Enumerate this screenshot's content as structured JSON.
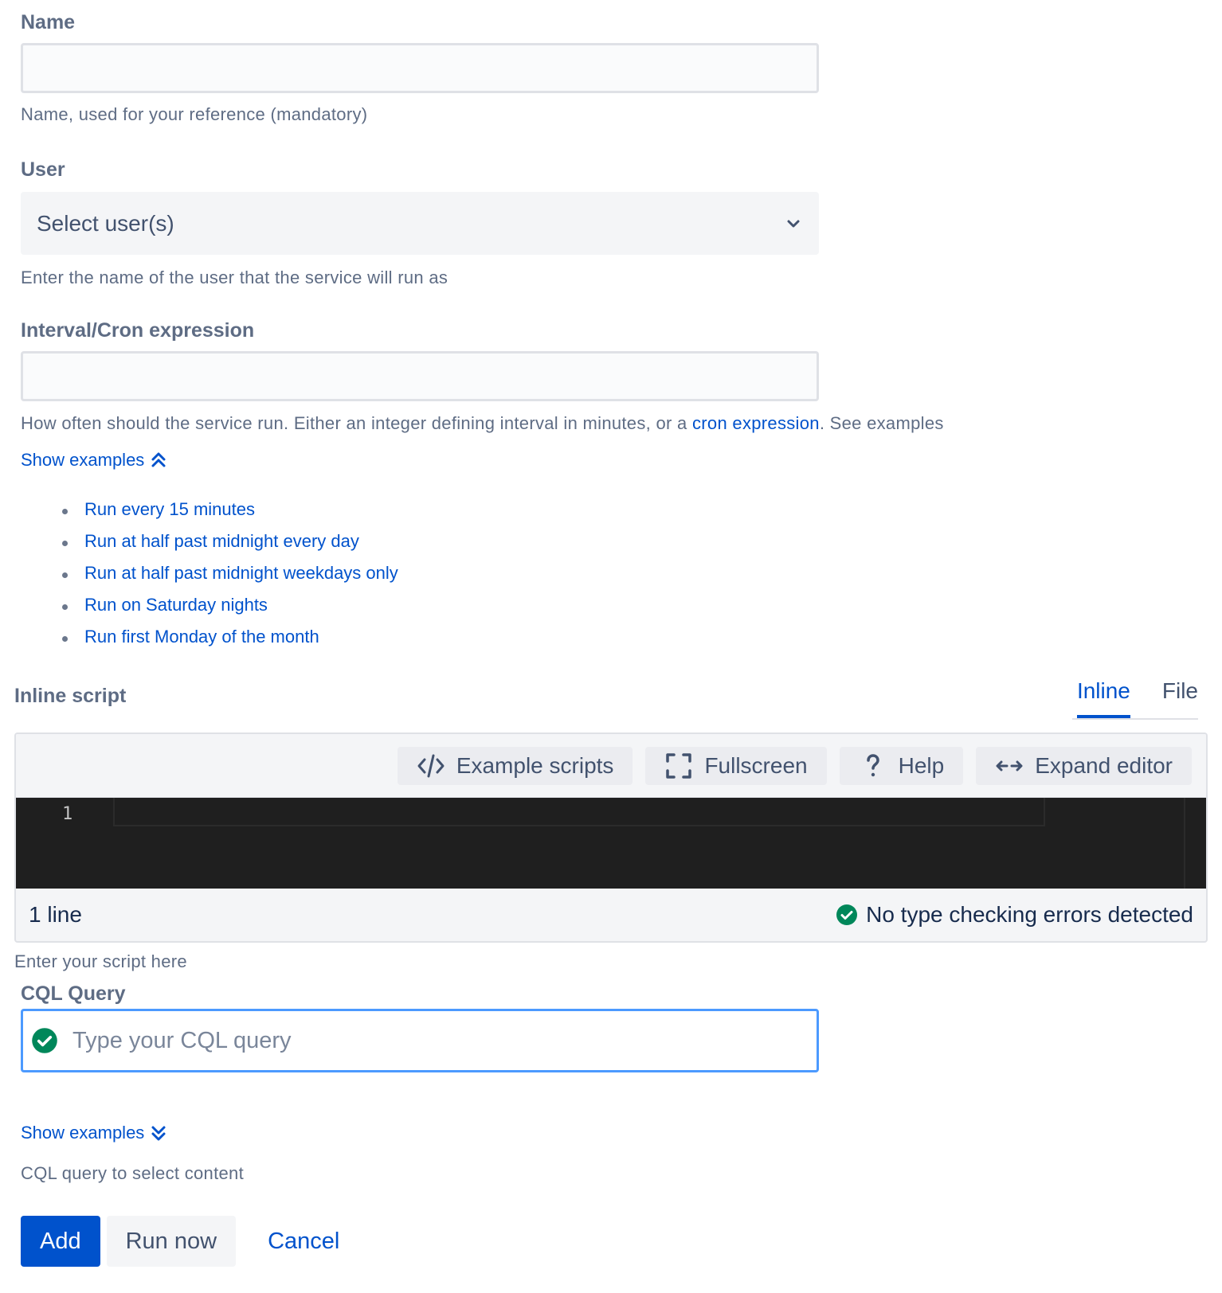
{
  "name_field": {
    "label": "Name",
    "value": "",
    "help": "Name, used for your reference (mandatory)"
  },
  "user_field": {
    "label": "User",
    "placeholder": "Select user(s)",
    "help": "Enter the name of the user that the service will run as"
  },
  "interval_field": {
    "label": "Interval/Cron expression",
    "value": "",
    "help_before": "How often should the service run. Either an integer defining interval in minutes, or a ",
    "help_link": "cron expression",
    "help_after": ". See examples",
    "toggle_label": "Show examples",
    "examples": [
      "Run every 15 minutes",
      "Run at half past midnight every day",
      "Run at half past midnight weekdays only",
      "Run on Saturday nights",
      "Run first Monday of the month"
    ]
  },
  "script_field": {
    "label": "Inline script",
    "tabs": [
      "Inline",
      "File"
    ],
    "active_tab": "Inline",
    "toolbar": {
      "example_scripts": "Example scripts",
      "fullscreen": "Fullscreen",
      "help": "Help",
      "expand_editor": "Expand editor"
    },
    "line_number": "1",
    "line_count": "1 line",
    "type_status": "No type checking errors detected",
    "help": "Enter your script here"
  },
  "cql_field": {
    "label": "CQL Query",
    "placeholder": "Type your CQL query",
    "toggle_label": "Show examples",
    "help": "CQL query to select content"
  },
  "actions": {
    "add": "Add",
    "run_now": "Run now",
    "cancel": "Cancel"
  },
  "colors": {
    "primary": "#0052cc",
    "success": "#00875a",
    "focus_border": "#4c9aff",
    "editor_bg": "#1f1f1f"
  }
}
